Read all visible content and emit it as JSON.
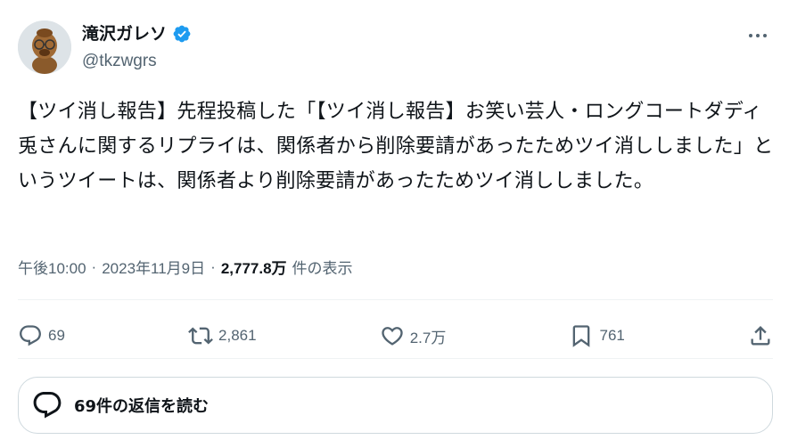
{
  "author": {
    "display_name": "滝沢ガレソ",
    "handle": "@tkzwgrs",
    "verified": true
  },
  "tweet": {
    "text": "【ツイ消し報告】先程投稿した「【ツイ消し報告】お笑い芸人・ロングコートダディ兎さんに関するリプライは、関係者から削除要請があったためツイ消ししました」というツイートは、関係者より削除要請があったためツイ消ししました。",
    "time": "午後10:00",
    "separator": "·",
    "date": "2023年11月9日",
    "views_count": "2,777.8万",
    "views_label": "件の表示"
  },
  "actions": {
    "reply_count": "69",
    "retweet_count": "2,861",
    "like_count": "2.7万",
    "bookmark_count": "761"
  },
  "replies_button": {
    "label": "69件の返信を読む"
  },
  "colors": {
    "verified": "#1d9bf0",
    "secondary_text": "#536471",
    "primary_text": "#0f1419",
    "border": "#cfd9de"
  }
}
